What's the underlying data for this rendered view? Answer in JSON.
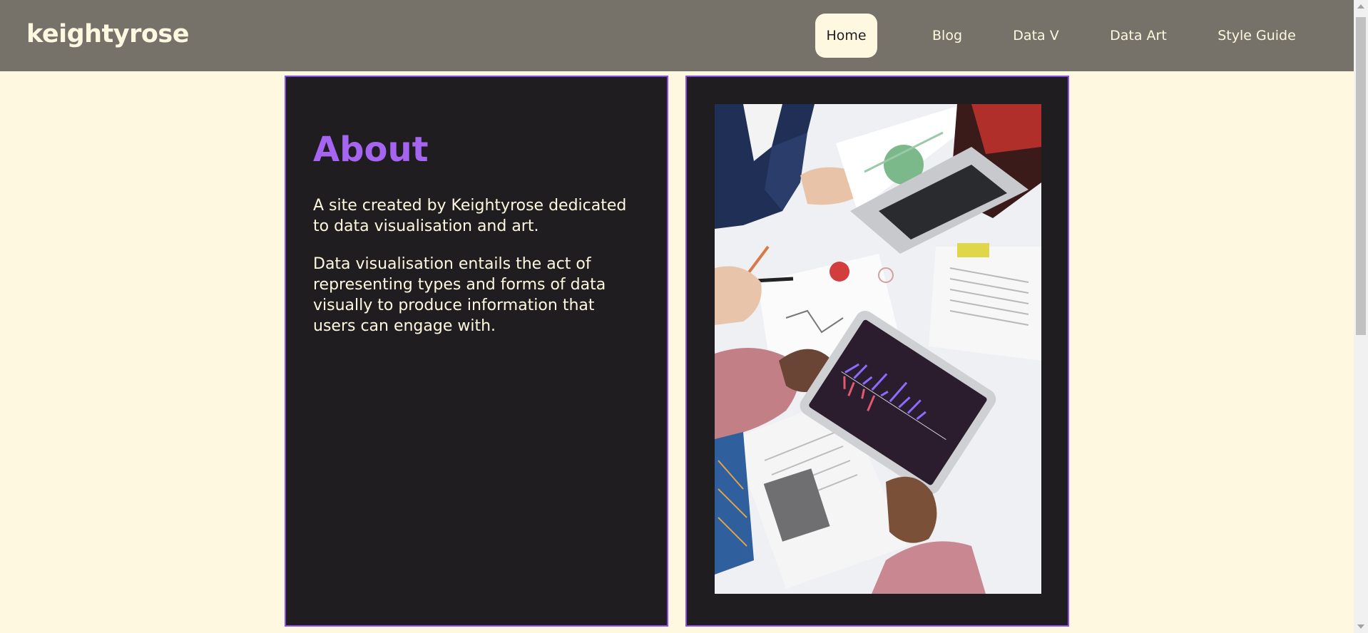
{
  "header": {
    "logo": "keightyrose",
    "nav": [
      {
        "label": "Home",
        "active": true
      },
      {
        "label": "Blog",
        "active": false
      },
      {
        "label": "Data V",
        "active": false
      },
      {
        "label": "Data Art",
        "active": false
      },
      {
        "label": "Style Guide",
        "active": false
      }
    ]
  },
  "about": {
    "title": "About",
    "paragraphs": [
      "A site created by Keightyrose dedicated to data visualisation and art.",
      "Data visualisation entails the act of representing types and forms of data visually to produce information that users can engage with."
    ]
  },
  "image": {
    "name": "team-reviewing-data-on-tablet-photo"
  },
  "colors": {
    "background": "#fff8e0",
    "header": "#767269",
    "card": "#1f1d20",
    "card_border": "#8a4fe0",
    "title_accent": "#a565f0",
    "text_light": "#fff8e0"
  }
}
